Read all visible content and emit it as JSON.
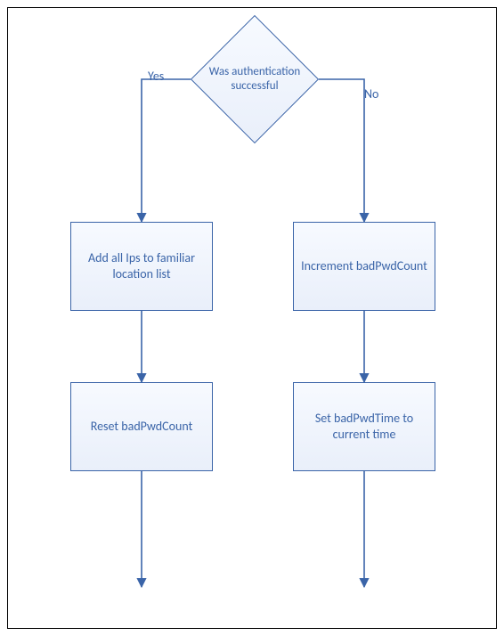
{
  "decision": {
    "text": "Was authentication successful"
  },
  "edges": {
    "yes_label": "Yes",
    "no_label": "No"
  },
  "yes_branch": {
    "step1": "Add all Ips to familiar location list",
    "step2": "Reset badPwdCount"
  },
  "no_branch": {
    "step1": "Increment badPwdCount",
    "step2": "Set badPwdTime to current time"
  },
  "chart_data": {
    "type": "diagram",
    "flow": {
      "decision": "Was authentication successful",
      "branches": [
        {
          "label": "Yes",
          "steps": [
            "Add all Ips to familiar location list",
            "Reset badPwdCount"
          ]
        },
        {
          "label": "No",
          "steps": [
            "Increment badPwdCount",
            "Set badPwdTime to current time"
          ]
        }
      ]
    }
  }
}
